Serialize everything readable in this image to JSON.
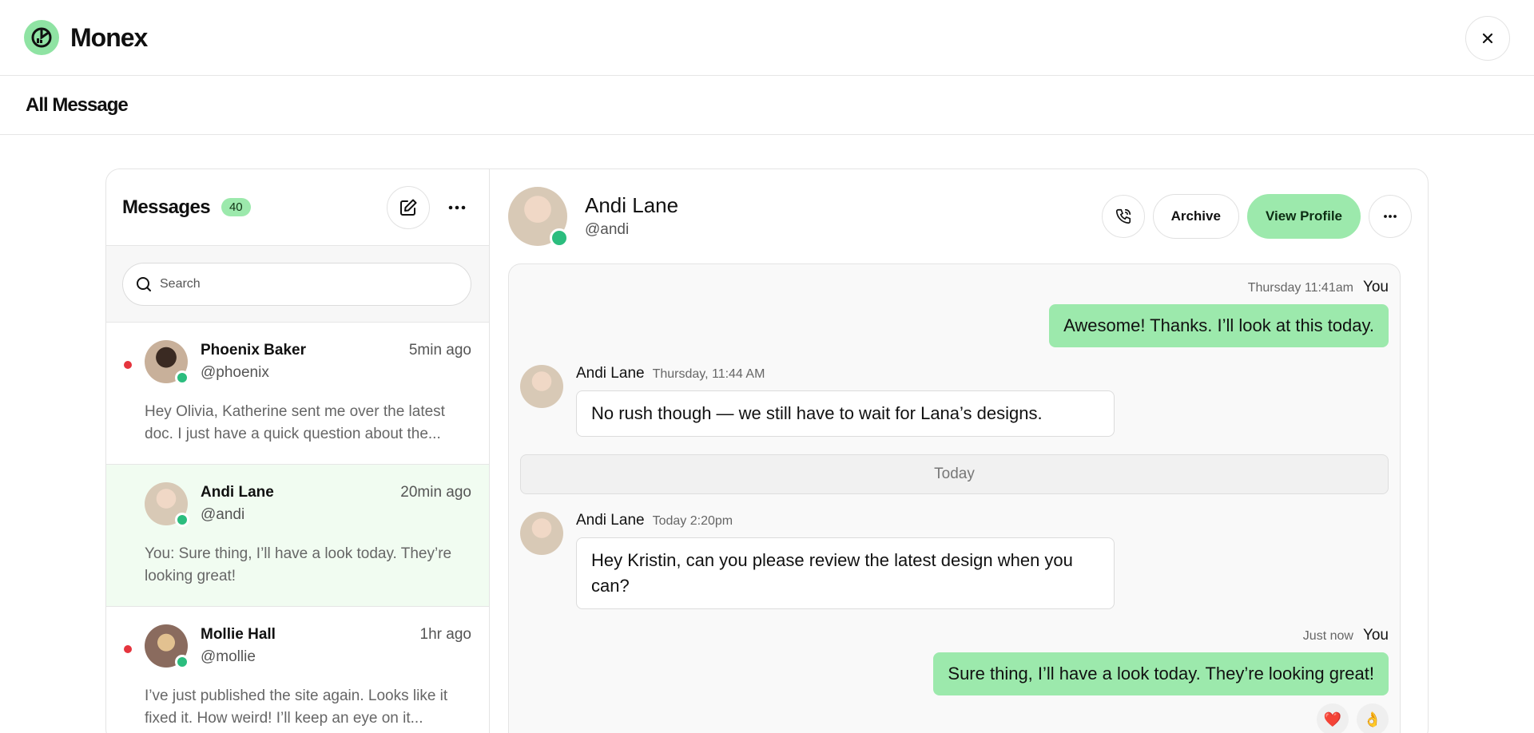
{
  "app": {
    "name": "Monex"
  },
  "page": {
    "title": "All Message"
  },
  "messages_panel": {
    "title": "Messages",
    "count": "40",
    "search_placeholder": "Search",
    "conversations": [
      {
        "name": "Phoenix Baker",
        "handle": "@phoenix",
        "time": "5min ago",
        "preview": "Hey Olivia, Katherine sent me over the latest doc. I just have a quick question about the...",
        "unread": true,
        "online": true,
        "avatar_color": "#6b5546"
      },
      {
        "name": "Andi Lane",
        "handle": "@andi",
        "time": "20min ago",
        "preview": "You: Sure thing, I’ll have a look today. They’re looking great!",
        "unread": false,
        "online": true,
        "avatar_color": "#d8c9b6"
      },
      {
        "name": "Mollie Hall",
        "handle": "@mollie",
        "time": "1hr ago",
        "preview": "I’ve just published the site again. Looks like it fixed it. How weird! I’ll keep an eye on it...",
        "unread": true,
        "online": true,
        "avatar_color": "#8a6b5e"
      }
    ]
  },
  "chat": {
    "contact_name": "Andi Lane",
    "contact_handle": "@andi",
    "actions": {
      "archive": "Archive",
      "view_profile": "View Profile"
    },
    "messages": [
      {
        "type": "out",
        "time": "Thursday 11:41am",
        "sender": "You",
        "text": "Awesome! Thanks. I’ll look at this today."
      },
      {
        "type": "in",
        "sender": "Andi Lane",
        "time": "Thursday, 11:44 AM",
        "text": "No rush though — we still have to wait for Lana’s designs."
      },
      {
        "type": "divider",
        "label": "Today"
      },
      {
        "type": "in",
        "sender": "Andi Lane",
        "time": "Today 2:20pm",
        "text": "Hey Kristin, can you please review the latest design when you can?"
      },
      {
        "type": "out",
        "time": "Just now",
        "sender": "You",
        "text": "Sure thing, I’ll have a look today. They’re looking great!"
      }
    ],
    "reactions": [
      "❤️",
      "👌"
    ]
  },
  "colors": {
    "accent": "#9ce9ac",
    "online": "#2bbd7e",
    "unread": "#e5343d",
    "active_row": "#f1fcf1"
  }
}
